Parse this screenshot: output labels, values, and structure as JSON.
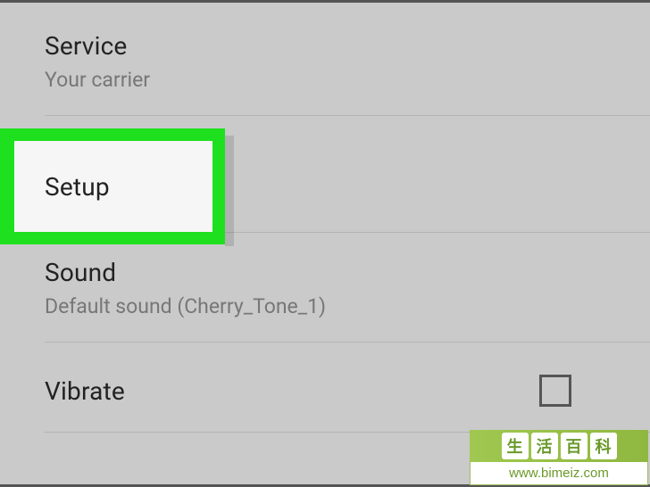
{
  "settings": {
    "service": {
      "title": "Service",
      "subtitle": "Your carrier"
    },
    "setup": {
      "title": "Setup"
    },
    "sound": {
      "title": "Sound",
      "subtitle": "Default sound (Cherry_Tone_1)"
    },
    "vibrate": {
      "title": "Vibrate",
      "checked": false
    }
  },
  "watermark": {
    "chars": [
      "生",
      "活",
      "百",
      "科"
    ],
    "url": "www.bimeiz.com"
  }
}
